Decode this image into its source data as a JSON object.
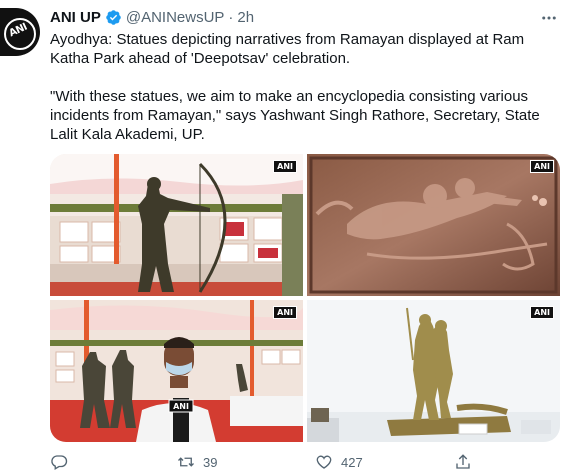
{
  "account": {
    "name": "ANI UP",
    "handle": "@ANINewsUP",
    "separator": "·",
    "time": "2h",
    "avatar_text": "ANI"
  },
  "tweet": {
    "paragraph1": "Ayodhya: Statues depicting narratives from Ramayan displayed at Ram Katha Park ahead of 'Deepotsav' celebration.",
    "paragraph2": "\"With these statues, we aim to make an encyclopedia consisting various incidents from Ramayan,\" says Yashwant Singh Rathore, Secretary, State Lalit Kala Akademi, UP."
  },
  "media": {
    "watermark": "ANI",
    "mic_label": "ANI",
    "images": [
      {
        "description_icon": "statue-archer-image"
      },
      {
        "description_icon": "hanuman-relief-image"
      },
      {
        "description_icon": "reporter-interview-image"
      },
      {
        "description_icon": "ram-sita-statue-image"
      }
    ]
  },
  "actions": {
    "reply_count": "",
    "retweet_count": "39",
    "like_count": "427",
    "share_count": ""
  },
  "colors": {
    "verified": "#1d9bf0",
    "secondary_text": "#536471",
    "primary_text": "#0f1419"
  }
}
